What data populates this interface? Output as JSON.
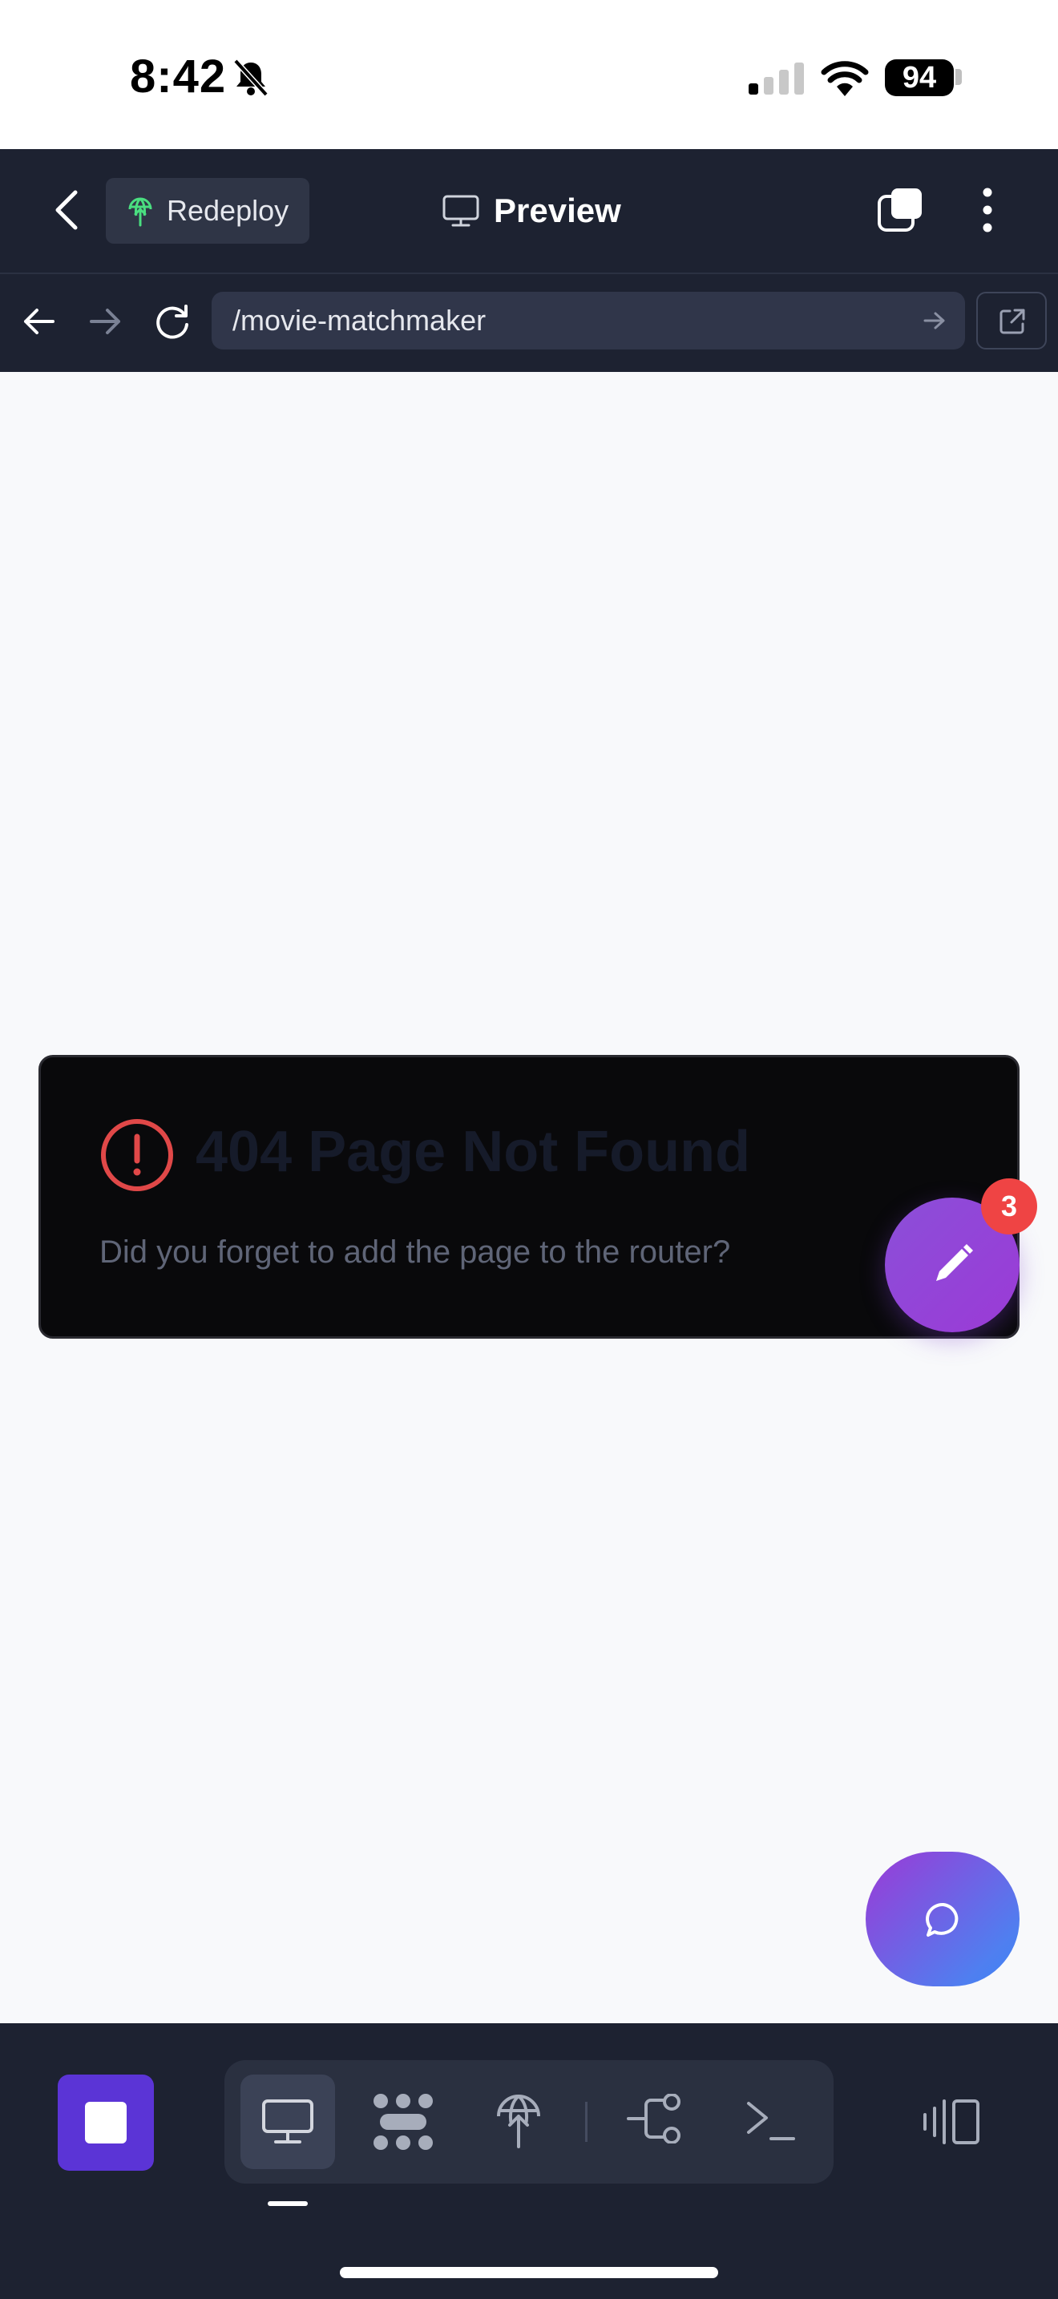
{
  "status_bar": {
    "time": "8:42",
    "battery": "94",
    "silent_icon": "bell-slash-icon",
    "signal_icon": "cellular-signal-icon",
    "wifi_icon": "wifi-icon"
  },
  "app_bar": {
    "back_icon": "chevron-left-icon",
    "redeploy_label": "Redeploy",
    "redeploy_icon": "globe-upload-icon",
    "title": "Preview",
    "title_icon": "monitor-icon",
    "tabs_icon": "tabs-icon",
    "more_icon": "vertical-dots-icon"
  },
  "url_bar": {
    "path": "/movie-matchmaker",
    "back_icon": "arrow-left-icon",
    "forward_icon": "arrow-right-icon",
    "reload_icon": "reload-icon",
    "go_icon": "arrow-right-icon",
    "external_icon": "external-link-icon"
  },
  "error_card": {
    "title": "404 Page Not Found",
    "message": "Did you forget to add the page to the router?",
    "icon": "alert-circle-icon"
  },
  "fab_edit": {
    "badge": "3",
    "icon": "pencil-icon"
  },
  "fab_chat": {
    "icon": "chat-bubble-icon"
  },
  "bottom_bar": {
    "stop_icon": "stop-icon",
    "tools": [
      "monitor-icon",
      "dots-grid-icon",
      "globe-upload-icon",
      "branch-icon",
      "terminal-icon"
    ],
    "layout_icon": "split-panel-icon"
  },
  "colors": {
    "accent": "#5b34d6",
    "error": "#e04848",
    "badge": "#ef4444",
    "toolbar": "#1d2231"
  }
}
